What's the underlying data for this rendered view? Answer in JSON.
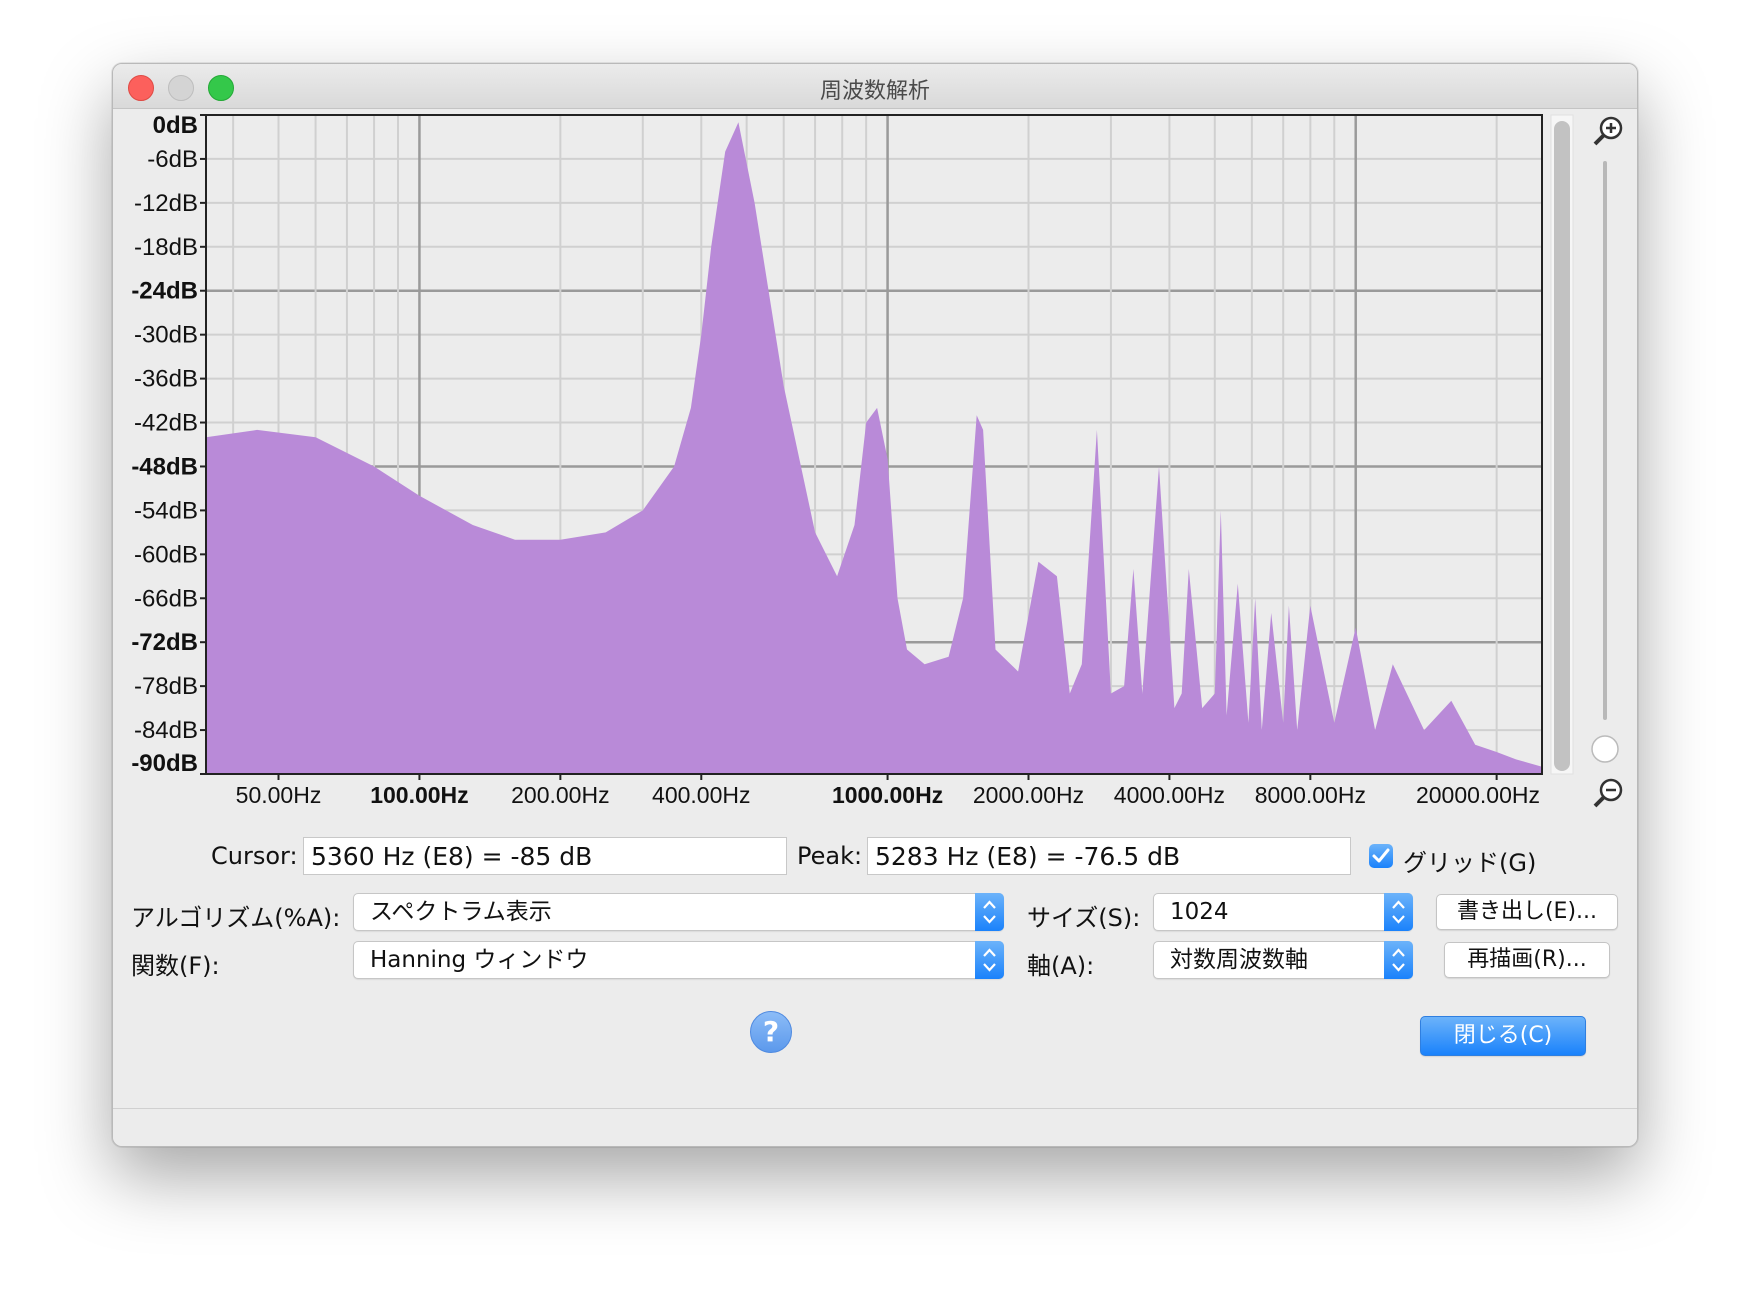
{
  "window": {
    "title": "周波数解析"
  },
  "chart_data": {
    "type": "area",
    "title": "",
    "x_scale": "log",
    "xlim": [
      35,
      25000
    ],
    "ylim": [
      -90,
      0
    ],
    "y_ticks": [
      "0dB",
      "-6dB",
      "-12dB",
      "-18dB",
      "-24dB",
      "-30dB",
      "-36dB",
      "-42dB",
      "-48dB",
      "-54dB",
      "-60dB",
      "-66dB",
      "-72dB",
      "-78dB",
      "-84dB",
      "-90dB"
    ],
    "x_ticks": [
      "50.00Hz",
      "100.00Hz",
      "200.00Hz",
      "400.00Hz",
      "1000.00Hz",
      "2000.00Hz",
      "4000.00Hz",
      "8000.00Hz",
      "20000.00Hz"
    ],
    "grid": true,
    "fill_color": "#b98ad8",
    "series": [
      {
        "x": [
          35,
          45,
          60,
          80,
          100,
          130,
          160,
          200,
          250,
          300,
          350,
          380,
          400,
          420,
          450,
          480,
          520,
          600,
          700,
          780,
          850,
          900,
          950,
          1000,
          1050,
          1100,
          1200,
          1350,
          1450,
          1550,
          1600,
          1700,
          1900,
          2100,
          2300,
          2450,
          2600,
          2800,
          3000,
          3200,
          3350,
          3500,
          3800,
          4100,
          4250,
          4400,
          4700,
          5000,
          5150,
          5300,
          5600,
          5900,
          6100,
          6300,
          6600,
          7000,
          7200,
          7500,
          8000,
          9000,
          10000,
          11000,
          12000,
          14000,
          16000,
          18000,
          20000,
          22000,
          25000
        ],
        "y": [
          -44,
          -43,
          -44,
          -48,
          -52,
          -56,
          -58,
          -58,
          -57,
          -54,
          -48,
          -40,
          -30,
          -18,
          -5,
          -1,
          -12,
          -37,
          -57,
          -63,
          -56,
          -42,
          -40,
          -47,
          -66,
          -73,
          -75,
          -74,
          -66,
          -41,
          -43,
          -73,
          -76,
          -61,
          -63,
          -79,
          -75,
          -43,
          -79,
          -78,
          -62,
          -79,
          -48,
          -81,
          -79,
          -62,
          -81,
          -79,
          -54,
          -82,
          -64,
          -83,
          -66,
          -84,
          -68,
          -83,
          -67,
          -84,
          -67,
          -83,
          -70,
          -84,
          -75,
          -84,
          -80,
          -86,
          -87,
          -88,
          -89
        ]
      }
    ]
  },
  "readouts": {
    "cursor_label": "Cursor:",
    "cursor_value": "5360 Hz (E8) = -85 dB",
    "peak_label": "Peak:",
    "peak_value": "5283 Hz (E8) = -76.5 dB",
    "grid_label": "グリッド(G)"
  },
  "controls": {
    "algorithm_label": "アルゴリズム(%A):",
    "algorithm_value": "スペクトラム表示",
    "function_label": "関数(F):",
    "function_value": "Hanning ウィンドウ",
    "size_label": "サイズ(S):",
    "size_value": "1024",
    "axis_label": "軸(A):",
    "axis_value": "対数周波数軸",
    "export_button": "書き出し(E)...",
    "redraw_button": "再描画(R)...",
    "close_button": "閉じる(C)",
    "help_icon": "?"
  },
  "colors": {
    "accent": "#1a82fb",
    "fill": "#b98ad8"
  },
  "icons": {
    "zoom_in": "zoom-in-icon",
    "zoom_out": "zoom-out-icon",
    "help": "help-icon",
    "check": "checkmark-icon"
  }
}
